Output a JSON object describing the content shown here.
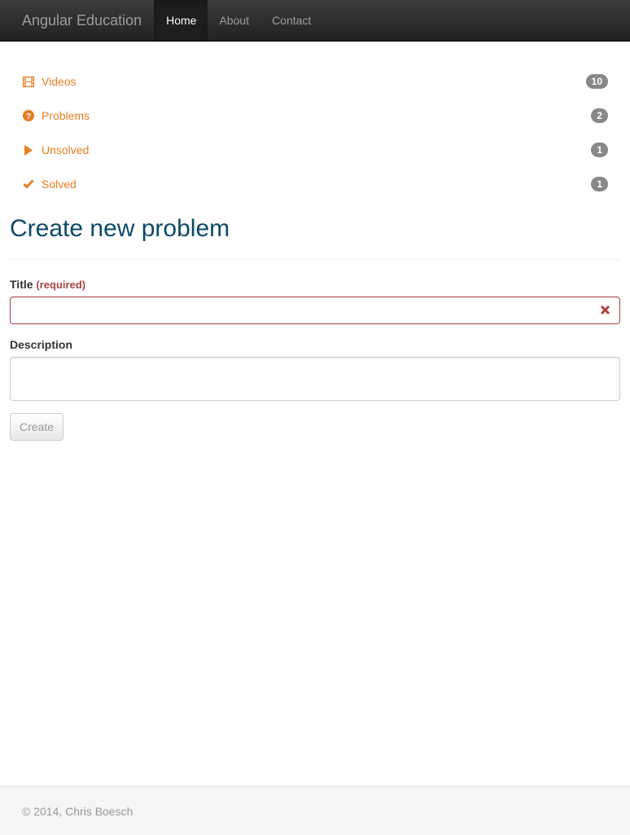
{
  "nav": {
    "brand": "Angular Education",
    "items": [
      {
        "label": "Home",
        "active": true
      },
      {
        "label": "About",
        "active": false
      },
      {
        "label": "Contact",
        "active": false
      }
    ]
  },
  "stats": [
    {
      "icon": "film-icon",
      "label": "Videos",
      "count": "10"
    },
    {
      "icon": "question-circle-icon",
      "label": "Problems",
      "count": "2"
    },
    {
      "icon": "play-icon",
      "label": "Unsolved",
      "count": "1"
    },
    {
      "icon": "check-icon",
      "label": "Solved",
      "count": "1"
    }
  ],
  "colors": {
    "accent": "#e67e22",
    "heading": "#0b4a66",
    "error": "#a94442",
    "badge": "#888888"
  },
  "form": {
    "heading": "Create new problem",
    "title_label": "Title",
    "title_required": "(required)",
    "title_value": "",
    "description_label": "Description",
    "description_value": "",
    "submit_label": "Create"
  },
  "footer": {
    "text": "© 2014, Chris Boesch"
  }
}
